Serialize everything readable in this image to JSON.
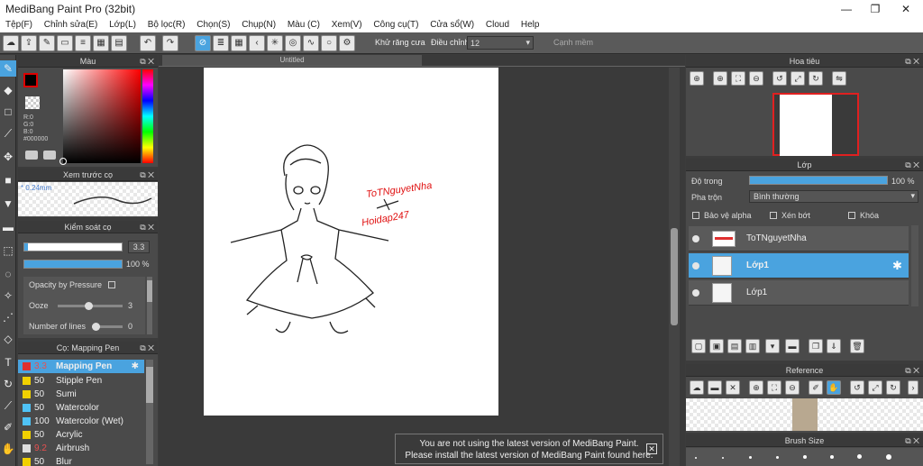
{
  "window": {
    "title": "MediBang Paint Pro (32bit)",
    "controls": [
      "—",
      "❐",
      "✕"
    ]
  },
  "menu": [
    "Tệp(F)",
    "Chỉnh sửa(E)",
    "Lớp(L)",
    "Bộ lọc(R)",
    "Chọn(S)",
    "Chụp(N)",
    "Màu (C)",
    "Xem(V)",
    "Công cụ(T)",
    "Cửa sổ(W)",
    "Cloud",
    "Help"
  ],
  "toolbar": {
    "antialias_label": "Khử răng cưa",
    "adjust_label": "Điều chỉnh",
    "adjust_value": "12",
    "snap_label": "Cạnh mềm"
  },
  "color_panel": {
    "title": "Màu",
    "rgb": [
      "R:0",
      "G:0",
      "B:0"
    ],
    "hex": "#000000",
    "current_color": "#000000"
  },
  "brush_preview": {
    "title": "Xem trước cọ",
    "size": "* 0.24mm"
  },
  "brush_control": {
    "title": "Kiểm soát cọ",
    "size": "3.3",
    "opacity": "100 %",
    "opacity_by_pressure": "Opacity by Pressure",
    "ooze_label": "Ooze",
    "ooze_value": "3",
    "lines_label": "Number of lines",
    "lines_value": "0"
  },
  "brush_list": {
    "title": "Cọ: Mapping Pen",
    "items": [
      {
        "size": "3.3",
        "name": "Mapping Pen",
        "color": "#e03030",
        "selected": true
      },
      {
        "size": "50",
        "name": "Stipple Pen",
        "color": "#f0d000"
      },
      {
        "size": "50",
        "name": "Sumi",
        "color": "#f0d000"
      },
      {
        "size": "50",
        "name": "Watercolor",
        "color": "#4fc3f7"
      },
      {
        "size": "100",
        "name": "Watercolor (Wet)",
        "color": "#4fc3f7"
      },
      {
        "size": "50",
        "name": "Acrylic",
        "color": "#f0d000"
      },
      {
        "size": "9.2",
        "name": "Airbrush",
        "color": "#dddddd"
      },
      {
        "size": "50",
        "name": "Blur",
        "color": "#f0d000"
      }
    ]
  },
  "canvas": {
    "tab": "Untitled",
    "watermark_name": "ToTNguyetNha",
    "watermark_site": "Hoidap247"
  },
  "navigator": {
    "title": "Hoa tiêu"
  },
  "layers": {
    "title": "Lớp",
    "opacity_label": "Độ trong",
    "opacity_value": "100 %",
    "opacity_fraction": 1.0,
    "blend_label": "Pha trộn",
    "blend_value": "Bình thường",
    "protect_alpha": "Bảo vệ alpha",
    "clipping": "Xén bớt",
    "lock": "Khóa",
    "items": [
      {
        "name": "ToTNguyetNha"
      },
      {
        "name": "Lớp1",
        "selected": true
      },
      {
        "name": "Lớp1"
      }
    ]
  },
  "reference": {
    "title": "Reference"
  },
  "brush_size": {
    "title": "Brush Size"
  },
  "notification": {
    "line1": "You are not using the latest version of MediBang Paint.",
    "line2": "Please install the latest version of MediBang Paint found here."
  }
}
